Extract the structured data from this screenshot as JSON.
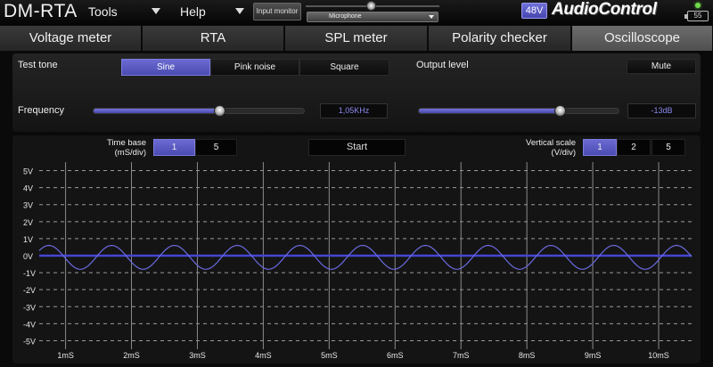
{
  "app": {
    "title": "DM-RTA",
    "menus": [
      {
        "label": "Tools"
      },
      {
        "label": "Help"
      }
    ],
    "input_monitor_label": "Input monitor",
    "input_source": "Microphone",
    "phantom_power_label": "48V",
    "logo_text": "AudioControl",
    "battery_level": "55",
    "accent_color": "#5656c0"
  },
  "tabs": [
    {
      "label": "Voltage meter",
      "active": false
    },
    {
      "label": "RTA",
      "active": false
    },
    {
      "label": "SPL meter",
      "active": false
    },
    {
      "label": "Polarity checker",
      "active": false
    },
    {
      "label": "Oscilloscope",
      "active": true
    }
  ],
  "settings": {
    "test_tone_label": "Test tone",
    "tone_options": [
      {
        "label": "Sine",
        "selected": true
      },
      {
        "label": "Pink noise",
        "selected": false
      },
      {
        "label": "Square",
        "selected": false
      }
    ],
    "output_level_label": "Output level",
    "mute_label": "Mute",
    "frequency_label": "Frequency",
    "frequency_value": "1,05KHz",
    "frequency_slider_fraction": 0.6,
    "output_level_value": "-13dB",
    "output_slider_fraction": 0.71
  },
  "scope": {
    "time_base_label": "Time base (mS/div)",
    "time_base_options": [
      {
        "label": "1",
        "selected": true
      },
      {
        "label": "5",
        "selected": false
      }
    ],
    "start_label": "Start",
    "vertical_scale_label": "Vertical scale (V/div)",
    "vertical_scale_options": [
      {
        "label": "1",
        "selected": true
      },
      {
        "label": "2",
        "selected": false
      },
      {
        "label": "5",
        "selected": false
      }
    ],
    "y_ticks": [
      "5V",
      "4V",
      "3V",
      "2V",
      "1V",
      "0V",
      "-1V",
      "-2V",
      "-3V",
      "-4V",
      "-5V"
    ],
    "x_ticks": [
      "1mS",
      "2mS",
      "3mS",
      "4mS",
      "5mS",
      "6mS",
      "7mS",
      "8mS",
      "9mS",
      "10mS"
    ],
    "trace_color": "#6a6ae0",
    "baseline_color": "#4646d0"
  },
  "chart_data": {
    "type": "line",
    "xlabel": "",
    "ylabel": "",
    "xlim": [
      0.6,
      10.5
    ],
    "ylim": [
      -5.5,
      5.5
    ],
    "grid": true,
    "series": [
      {
        "amplitude_v": 0.7,
        "frequency_khz": 1.05,
        "offset_v": -0.1
      }
    ]
  }
}
